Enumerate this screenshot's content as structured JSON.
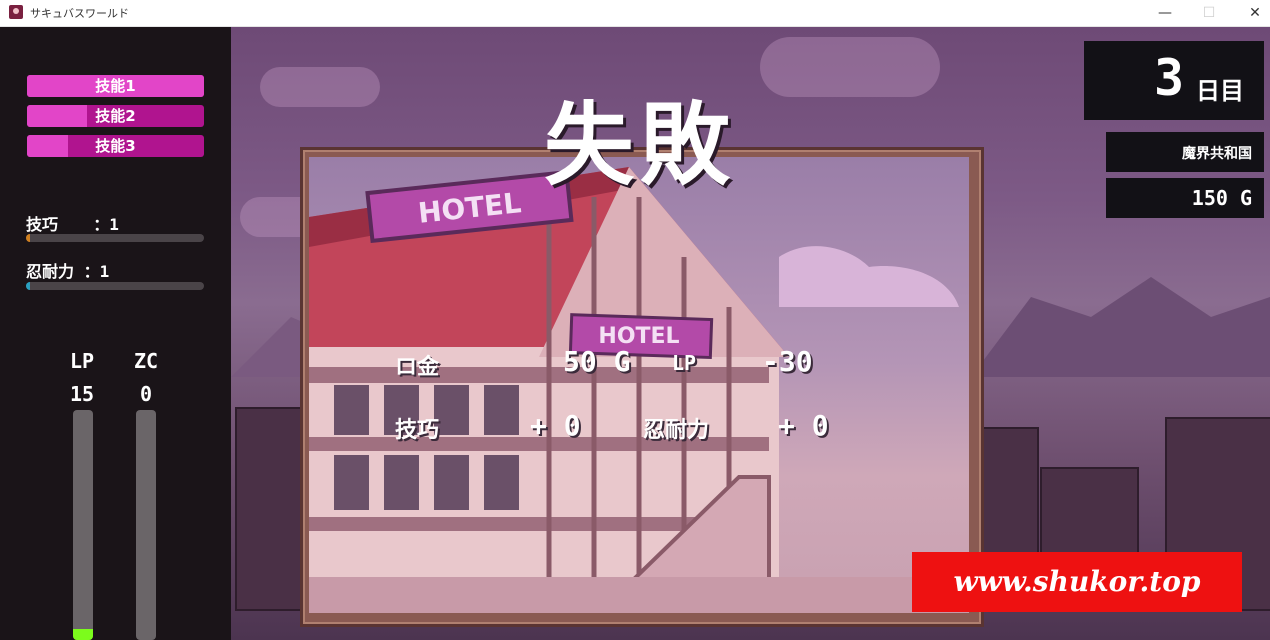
{
  "window": {
    "title": "サキュバスワールド",
    "minimize": "—",
    "maximize": "☐",
    "close": "✕"
  },
  "skills": [
    {
      "label": "技能1",
      "fill": 1.0
    },
    {
      "label": "技能2",
      "fill": 0.34
    },
    {
      "label": "技能3",
      "fill": 0.23
    }
  ],
  "stats": [
    {
      "label": "技巧 　 ：1",
      "color": "#d08020",
      "fill": 0.02
    },
    {
      "label": "忍耐力 ：1",
      "color": "#2aa0c0",
      "fill": 0.02
    }
  ],
  "gauges": {
    "lp": {
      "label": "LP",
      "value": "15",
      "fill": 0.05,
      "color": "#7cfc1c"
    },
    "zc": {
      "label": "ZC",
      "value": "0",
      "fill": 0.0
    }
  },
  "day": {
    "number": "3",
    "suffix": "日目"
  },
  "location": "魔界共和国",
  "gold": "150 G",
  "result": {
    "title": "失敗",
    "money_label": "ロ金",
    "money_value": "50 G",
    "lp_label": "LP",
    "lp_value": "-30",
    "skill_label": "技巧",
    "skill_value": "+ 0",
    "endurance_label": "忍耐力",
    "endurance_value": "+ 0"
  },
  "scene": {
    "sign_large": "HOTEL",
    "sign_small": "HOTEL"
  },
  "watermark": "www.shukor.top"
}
